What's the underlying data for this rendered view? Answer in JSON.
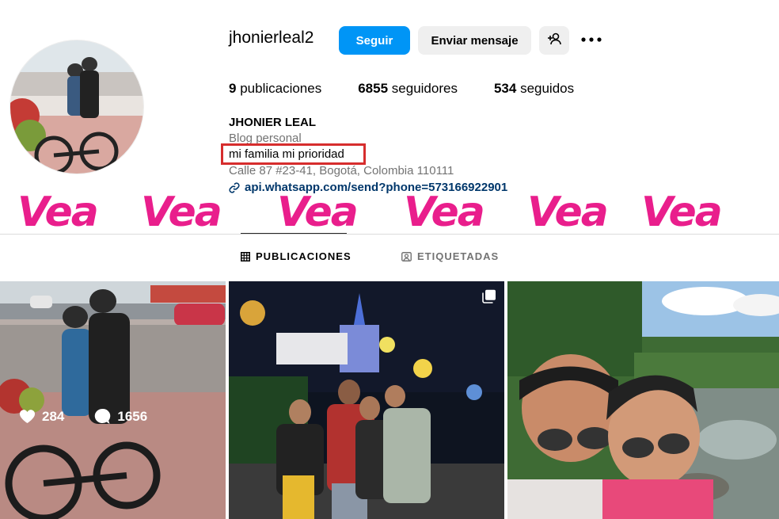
{
  "profile": {
    "username": "jhonierleal2",
    "full_name": "JHONIER LEAL",
    "category": "Blog personal",
    "bio": "mi familia mi prioridad",
    "address": "Calle 87 #23-41, Bogotá, Colombia 110111",
    "link": "api.whatsapp.com/send?phone=573166922901"
  },
  "actions": {
    "follow_label": "Seguir",
    "message_label": "Enviar mensaje"
  },
  "stats": {
    "posts_count": "9",
    "posts_label": "publicaciones",
    "followers_count": "6855",
    "followers_label": "seguidores",
    "following_count": "534",
    "following_label": "seguidos"
  },
  "watermark": [
    "Vea",
    "Vea",
    "Vea",
    "Vea",
    "Vea",
    "Vea"
  ],
  "tabs": {
    "posts": "PUBLICACIONES",
    "tagged": "ETIQUETADAS"
  },
  "posts": [
    {
      "likes": "284",
      "comments": "1656"
    }
  ],
  "colors": {
    "accent": "#0095f6",
    "highlight_box": "#d62d2d",
    "watermark": "#e91e8c",
    "link": "#00376b"
  },
  "icons": [
    "add-user-icon",
    "more-options-icon",
    "link-icon",
    "grid-icon",
    "tagged-icon",
    "heart-icon",
    "comment-icon",
    "multiple-photos-icon"
  ]
}
